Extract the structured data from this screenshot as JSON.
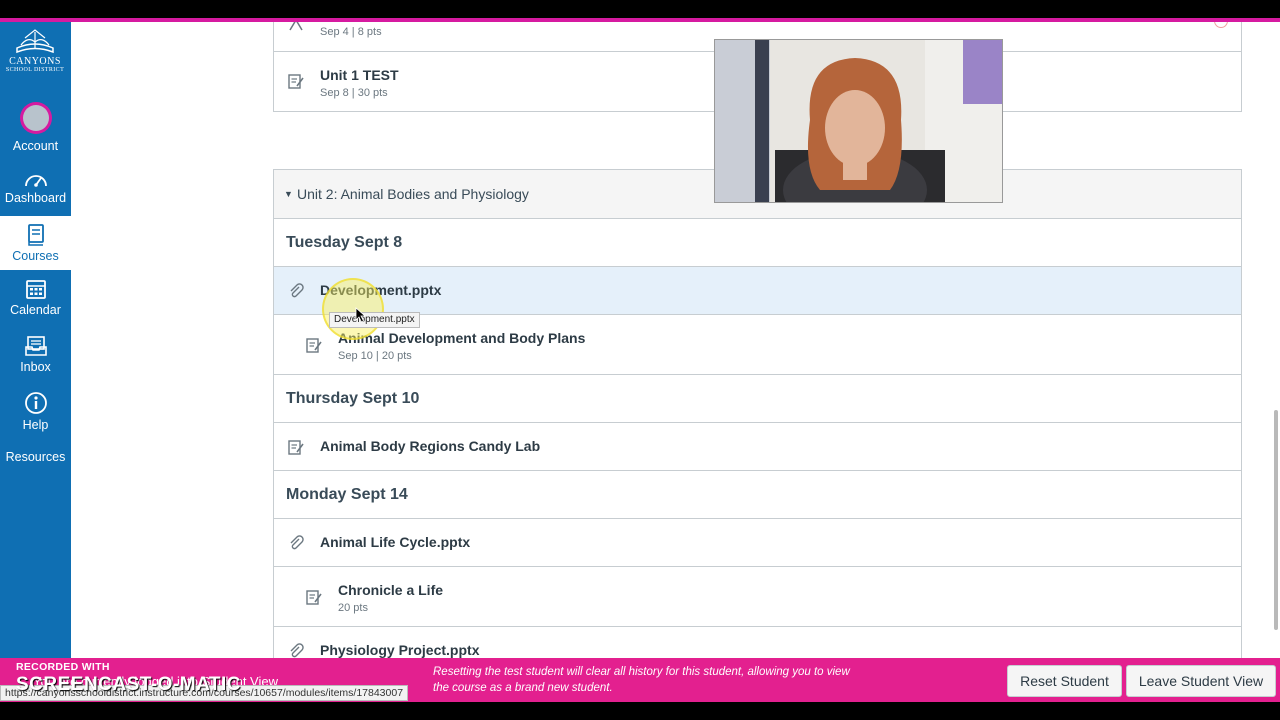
{
  "colors": {
    "nav_bg": "#0f6fb3",
    "banner": "#e3208f",
    "hilite": "#e5f0fa",
    "frame_accent": "#d61aa0"
  },
  "logo": {
    "line1": "CANYONS",
    "line2": "SCHOOL DISTRICT"
  },
  "nav": [
    {
      "label": "Account",
      "icon": "user-avatar-icon"
    },
    {
      "label": "Dashboard",
      "icon": "dashboard-gauge-icon"
    },
    {
      "label": "Courses",
      "icon": "courses-book-icon"
    },
    {
      "label": "Calendar",
      "icon": "calendar-icon"
    },
    {
      "label": "Inbox",
      "icon": "inbox-icon"
    },
    {
      "label": "Help",
      "icon": "help-icon"
    },
    {
      "label": "Resources",
      "icon": ""
    }
  ],
  "unit1": {
    "prev_item": {
      "meta": "Sep 4  |  8 pts"
    },
    "test": {
      "title": "Unit 1 TEST",
      "meta": "Sep 8  |  30 pts"
    }
  },
  "unit2": {
    "header": "Unit 2: Animal Bodies and Physiology",
    "groups": [
      {
        "heading": "Tuesday Sept 8"
      },
      {
        "heading": "Thursday Sept 10"
      },
      {
        "heading": "Monday Sept 14"
      }
    ],
    "items": [
      {
        "title": "Development.pptx",
        "meta": ""
      },
      {
        "title": "Animal Development and Body Plans",
        "meta": "Sep 10  |  20 pts"
      },
      {
        "title": "Animal Body Regions Candy Lab",
        "meta": ""
      },
      {
        "title": "Animal Life Cycle.pptx",
        "meta": ""
      },
      {
        "title": "Chronicle a Life",
        "meta": "20 pts"
      },
      {
        "title": "Physiology Project.pptx",
        "meta": ""
      }
    ]
  },
  "tooltip": "Development.pptx",
  "student_view": {
    "message": "You are currently logged into Student View",
    "description": "Resetting the test student will clear all history for this student, allowing you to view the course as a brand new student.",
    "reset_label": "Reset Student",
    "leave_label": "Leave Student View"
  },
  "status_url": "https://canyonsschooldistrict.instructure.com/courses/10657/modules/items/17843007",
  "watermark": {
    "line1": "RECORDED WITH",
    "line2": "SCREENCAST-O-MATIC"
  }
}
